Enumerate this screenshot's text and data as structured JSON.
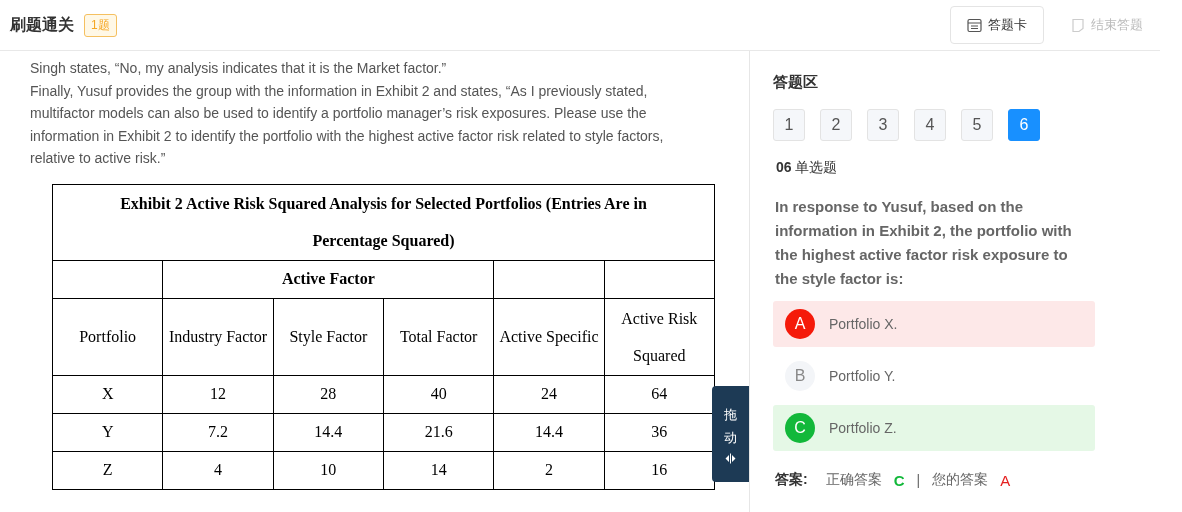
{
  "header": {
    "title": "刷题通关",
    "badge": "1题",
    "buttons": [
      {
        "label": "答题卡",
        "disabled": false
      },
      {
        "label": "结束答题",
        "disabled": true
      }
    ]
  },
  "passage": [
    "Singh states, “No, my analysis indicates that it is the Market factor.”",
    "Finally, Yusuf provides the group with the information in Exhibit 2 and states, “As I previously stated, multifactor models can also be used to identify a portfolio manager’s risk exposures. Please use the information in Exhibit 2 to identify the portfolio with the highest active factor risk related to style factors, relative to active risk.”"
  ],
  "table": {
    "caption": "Exhibit 2 Active Risk Squared Analysis for Selected Portfolios (Entries Are in Percentage Squared)",
    "group_header": "Active Factor",
    "columns": [
      "Portfolio",
      "Industry Factor",
      "Style Factor",
      "Total Factor",
      "Active Specific",
      "Active Risk Squared"
    ],
    "rows": [
      [
        "X",
        "12",
        "28",
        "40",
        "24",
        "64"
      ],
      [
        "Y",
        "7.2",
        "14.4",
        "21.6",
        "14.4",
        "36"
      ],
      [
        "Z",
        "4",
        "10",
        "14",
        "2",
        "16"
      ]
    ]
  },
  "drag_handle": {
    "label": "拖动"
  },
  "answer_area": {
    "title": "答题区",
    "numbers": [
      {
        "label": "1",
        "selected": false
      },
      {
        "label": "2",
        "selected": false
      },
      {
        "label": "3",
        "selected": false
      },
      {
        "label": "4",
        "selected": false
      },
      {
        "label": "5",
        "selected": false
      },
      {
        "label": "6",
        "selected": true
      }
    ],
    "question_number": "06",
    "question_type": "单选题",
    "question": "In response to Yusuf, based on the information in Exhibit 2, the portfolio with the highest active factor risk exposure to the style factor is:",
    "options": [
      {
        "letter": "A",
        "text": "Portfolio X.",
        "kind": "wrong"
      },
      {
        "letter": "B",
        "text": "Portfolio Y.",
        "kind": "plain"
      },
      {
        "letter": "C",
        "text": "Portfolio Z.",
        "kind": "correct"
      }
    ],
    "answer_label": "答案:",
    "correct_label": "正确答案",
    "correct_answer": "C",
    "separator": "|",
    "your_label": "您的答案",
    "your_answer": "A"
  }
}
